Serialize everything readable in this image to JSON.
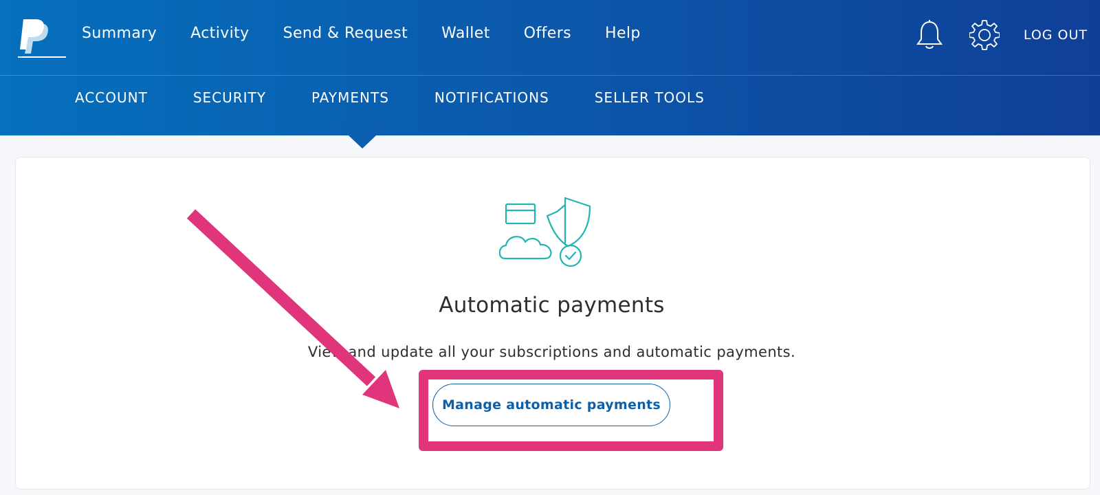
{
  "header": {
    "logo_icon": "paypal-logo",
    "nav": [
      {
        "label": "Summary"
      },
      {
        "label": "Activity"
      },
      {
        "label": "Send & Request"
      },
      {
        "label": "Wallet"
      },
      {
        "label": "Offers"
      },
      {
        "label": "Help"
      }
    ],
    "notifications_icon": "bell-icon",
    "settings_icon": "gear-icon",
    "logout_label": "LOG OUT"
  },
  "settings_nav": {
    "items": [
      {
        "label": "ACCOUNT"
      },
      {
        "label": "SECURITY"
      },
      {
        "label": "PAYMENTS"
      },
      {
        "label": "NOTIFICATIONS"
      },
      {
        "label": "SELLER TOOLS"
      }
    ],
    "active": "PAYMENTS"
  },
  "main": {
    "illustration_icon": "cloud-card-shield-icon",
    "title": "Automatic payments",
    "description": "View and update all your subscriptions and automatic payments.",
    "manage_button_label": "Manage automatic payments"
  },
  "annotation": {
    "color": "#e0357a",
    "shapes": [
      "arrow",
      "highlight-rectangle"
    ]
  },
  "colors": {
    "header_start": "#0570bd",
    "header_end": "#103f98",
    "accent": "#0c5fa8",
    "illustration": "#1fb5b0"
  }
}
